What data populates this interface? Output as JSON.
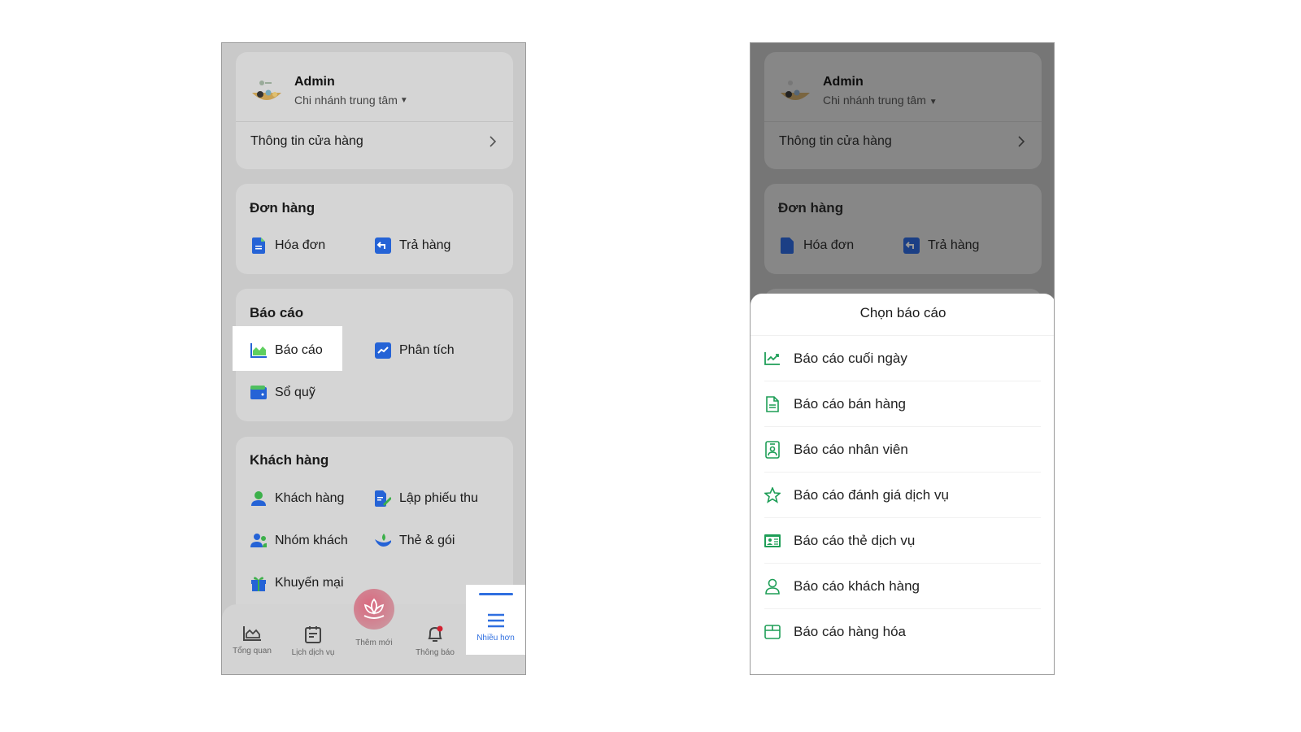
{
  "store": {
    "user": "Admin",
    "branch": "Chi nhánh trung tâm",
    "info_label": "Thông tin cửa hàng"
  },
  "orders": {
    "title": "Đơn hàng",
    "items": [
      "Hóa đơn",
      "Trả hàng"
    ]
  },
  "reports": {
    "title": "Báo cáo",
    "items": [
      "Báo cáo",
      "Phân tích",
      "Sổ quỹ"
    ]
  },
  "customers": {
    "title": "Khách hàng",
    "items": [
      "Khách hàng",
      "Lập phiếu thu",
      "Nhóm khách",
      "Thẻ & gói",
      "Khuyến mại"
    ]
  },
  "nav": {
    "tabs": [
      "Tổng quan",
      "Lịch dịch vụ",
      "Thêm mới",
      "Thông báo",
      "Nhiều hơn"
    ],
    "active": "Nhiều hơn"
  },
  "sheet": {
    "title": "Chọn báo cáo",
    "items": [
      "Báo cáo cuối ngày",
      "Báo cáo bán hàng",
      "Báo cáo nhân viên",
      "Báo cáo đánh giá dịch vụ",
      "Báo cáo thẻ dịch vụ",
      "Báo cáo khách hàng",
      "Báo cáo hàng hóa"
    ]
  },
  "colors": {
    "accent_blue": "#2f6fe0",
    "report_green": "#1e9e57",
    "lotus_pink": "#d9697f"
  }
}
